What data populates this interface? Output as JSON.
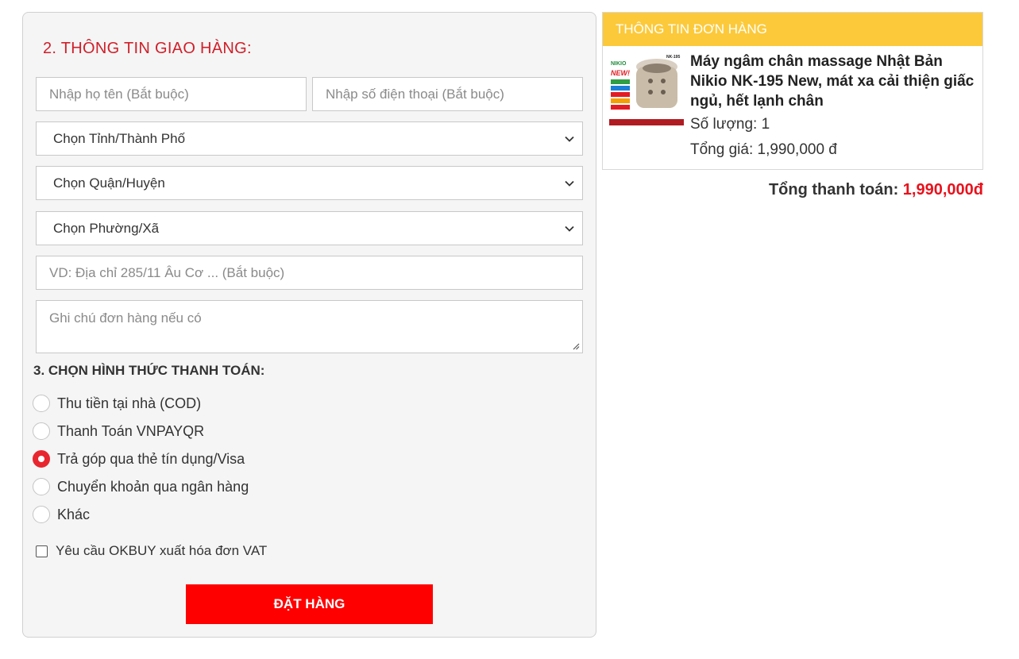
{
  "shipping": {
    "title": "2. THÔNG TIN GIAO HÀNG:",
    "name_placeholder": "Nhập họ tên (Bắt buộc)",
    "phone_placeholder": "Nhập số điện thoại (Bắt buộc)",
    "province_select": "Chọn Tỉnh/Thành Phố",
    "district_select": "Chọn Quận/Huyện",
    "ward_select": "Chọn Phường/Xã",
    "address_placeholder": "VD: Địa chỉ 285/11 Âu Cơ ... (Bắt buộc)",
    "note_placeholder": "Ghi chú đơn hàng nếu có"
  },
  "payment": {
    "title": "3. CHỌN HÌNH THỨC THANH TOÁN:",
    "options": [
      {
        "label": "Thu tiền tại nhà (COD)",
        "selected": false
      },
      {
        "label": "Thanh Toán VNPAYQR",
        "selected": false
      },
      {
        "label": "Trả góp qua thẻ tín dụng/Visa",
        "selected": true
      },
      {
        "label": "Chuyển khoản qua ngân hàng",
        "selected": false
      },
      {
        "label": "Khác",
        "selected": false
      }
    ],
    "vat_label": "Yêu cầu OKBUY xuất hóa đơn VAT",
    "vat_checked": false,
    "submit_label": "ĐẶT HÀNG"
  },
  "order": {
    "header": "THÔNG TIN ĐƠN HÀNG",
    "product_name": "Máy ngâm chân massage Nhật Bản Nikio NK-195 New, mát xa cải thiện giấc ngủ, hết lạnh chân",
    "quantity_text": "Số lượng: 1",
    "price_text": "Tổng giá: 1,990,000 đ",
    "total_label": "Tổng thanh toán:",
    "total_amount": "1,990,000đ",
    "thumbnail": {
      "brand": "NIKIO",
      "badge": "NEW!",
      "model": "NK-195"
    }
  },
  "colors": {
    "accent_red": "#d0202a",
    "button_red": "#ff0000",
    "header_yellow": "#fcc93a",
    "total_red": "#e8121c"
  }
}
